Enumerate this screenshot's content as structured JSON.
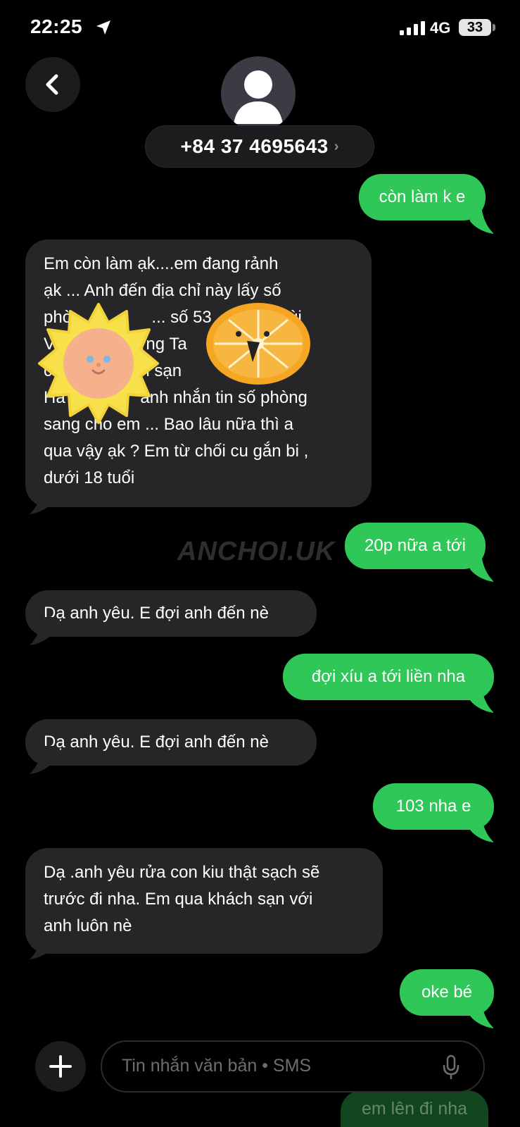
{
  "status": {
    "time": "22:25",
    "network": "4G",
    "battery": "33"
  },
  "header": {
    "contact_number": "+84 37 4695643"
  },
  "messages": [
    {
      "text": "còn làm k e"
    },
    {
      "text": "Em còn làm ạk....em đang rảnh ạk ... Anh đến địa chỉ này lấy số phò___e ... số 53___g Bùi V___ừng T___ông , ___ch sạn ___gọc Ha___anh nhắn tin số phòng sang cho em ... Bao lâu nữa thì a qua vậy ạk ? Em từ chối cu gắn bi , dưới 18 tuổi",
      "lines": [
        "Em còn làm ạk....em đang rảnh",
        "ạk ... Anh đến địa chỉ này lấy số",
        "phò                 ... số 53           g Bùi",
        "V                 ừng Ta                ông ,",
        "c                 ch sạn              ọc",
        "Ha                anh nhắn tin số phòng",
        "sang cho em ... Bao lâu nữa thì a",
        "qua vậy ạk ? Em từ chối cu gắn bi ,",
        "dưới 18 tuổi"
      ]
    },
    {
      "text": "20p nữa a tới"
    },
    {
      "text": "Dạ anh yêu. E đợi anh đến nè"
    },
    {
      "text": "đợi xíu a tới liền nha"
    },
    {
      "text": "Dạ anh yêu. E đợi anh đến nè"
    },
    {
      "text": "103 nha e"
    },
    {
      "text": "Dạ .anh yêu rửa con kiu thật sạch sẽ trước đi nha. Em qua khách sạn với anh luôn nè",
      "lines": [
        "Dạ .anh yêu rửa con kiu thật sạch sẽ",
        "trước đi nha. Em qua khách sạn với",
        "anh luôn nè"
      ]
    },
    {
      "text": "oke bé"
    },
    {
      "text": "em lên đi nha"
    }
  ],
  "watermark": "ANCHOI.UK",
  "composer": {
    "placeholder": "Tin nhắn văn bản • SMS"
  },
  "colors": {
    "sent_bubble": "#30c759",
    "received_bubble": "#262628",
    "background": "#000000"
  },
  "icons": [
    "location-arrow-icon",
    "signal-icon",
    "back-chevron-icon",
    "person-icon",
    "plus-icon",
    "mic-icon",
    "sun-sticker",
    "orange-sticker"
  ]
}
